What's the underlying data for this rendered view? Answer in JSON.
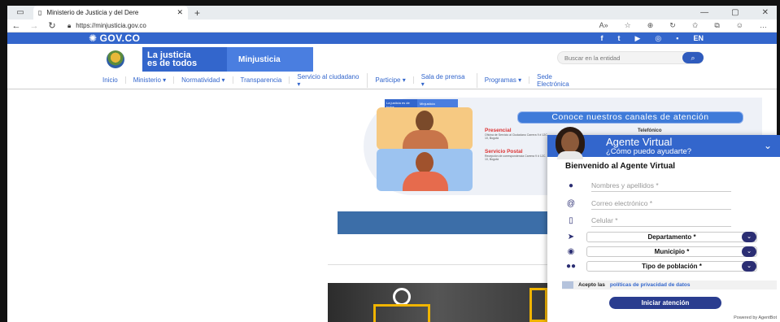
{
  "browser": {
    "tab_title": "Ministerio de Justicia y del Dere",
    "tab_close": "✕",
    "new_tab": "+",
    "url": "https://minjusticia.gov.co",
    "window_controls": [
      "—",
      "▢",
      "✕"
    ],
    "toolbar_icons": [
      "A»",
      "☆",
      "⊕",
      "↻",
      "✩",
      "⧉",
      "☺",
      "…"
    ]
  },
  "gov": {
    "logo": "GOV.CO",
    "social": [
      "f",
      "t",
      "▶",
      "◎",
      "▪",
      "EN"
    ]
  },
  "header": {
    "slogan_line1": "La justicia",
    "slogan_line2": "es de todos",
    "ministry": "Minjusticia",
    "search_placeholder": "Buscar en la entidad",
    "search_icon": "search-icon"
  },
  "nav": {
    "items": [
      {
        "label": "Inicio"
      },
      {
        "label": "Ministerio ▾"
      },
      {
        "label": "Normatividad ▾"
      },
      {
        "label": "Transparencia"
      },
      {
        "label": "Servicio al ciudadano ▾"
      },
      {
        "label": "Participe ▾"
      },
      {
        "label": "Sala de prensa ▾"
      },
      {
        "label": "Programas ▾"
      },
      {
        "label": "Sede Electrónica"
      }
    ]
  },
  "hero": {
    "channels_banner": "Conoce nuestros canales de atención",
    "presencial_title": "Presencial",
    "presencial_text": "Oficina de Servicio al Ciudadano Carrera 9 # 12C-10, Bogotá",
    "postal_title": "Servicio Postal",
    "postal_text": "Recepción de correspondencia Carrera 9 # 12C-10, Bogotá",
    "phone_title": "Telefónico",
    "logo_slogan": "La justicia es de todos",
    "logo_ministry": "Minjusticia"
  },
  "agent": {
    "title": "Agente Virtual",
    "subtitle": "¿Cómo puedo ayudarte?",
    "welcome": "Bienvenido al Agente Virtual",
    "fields": {
      "name": "Nombres y apellidos *",
      "email": "Correo electrónico *",
      "phone": "Celular *"
    },
    "selects": {
      "department": "Departamento *",
      "municipality": "Municipio *",
      "population": "Tipo de población *"
    },
    "consent_prefix": "Acepto las",
    "consent_link": "políticas de privacidad de datos",
    "start_button": "Iniciar atención",
    "powered_by": "Powered by AgentBot"
  }
}
